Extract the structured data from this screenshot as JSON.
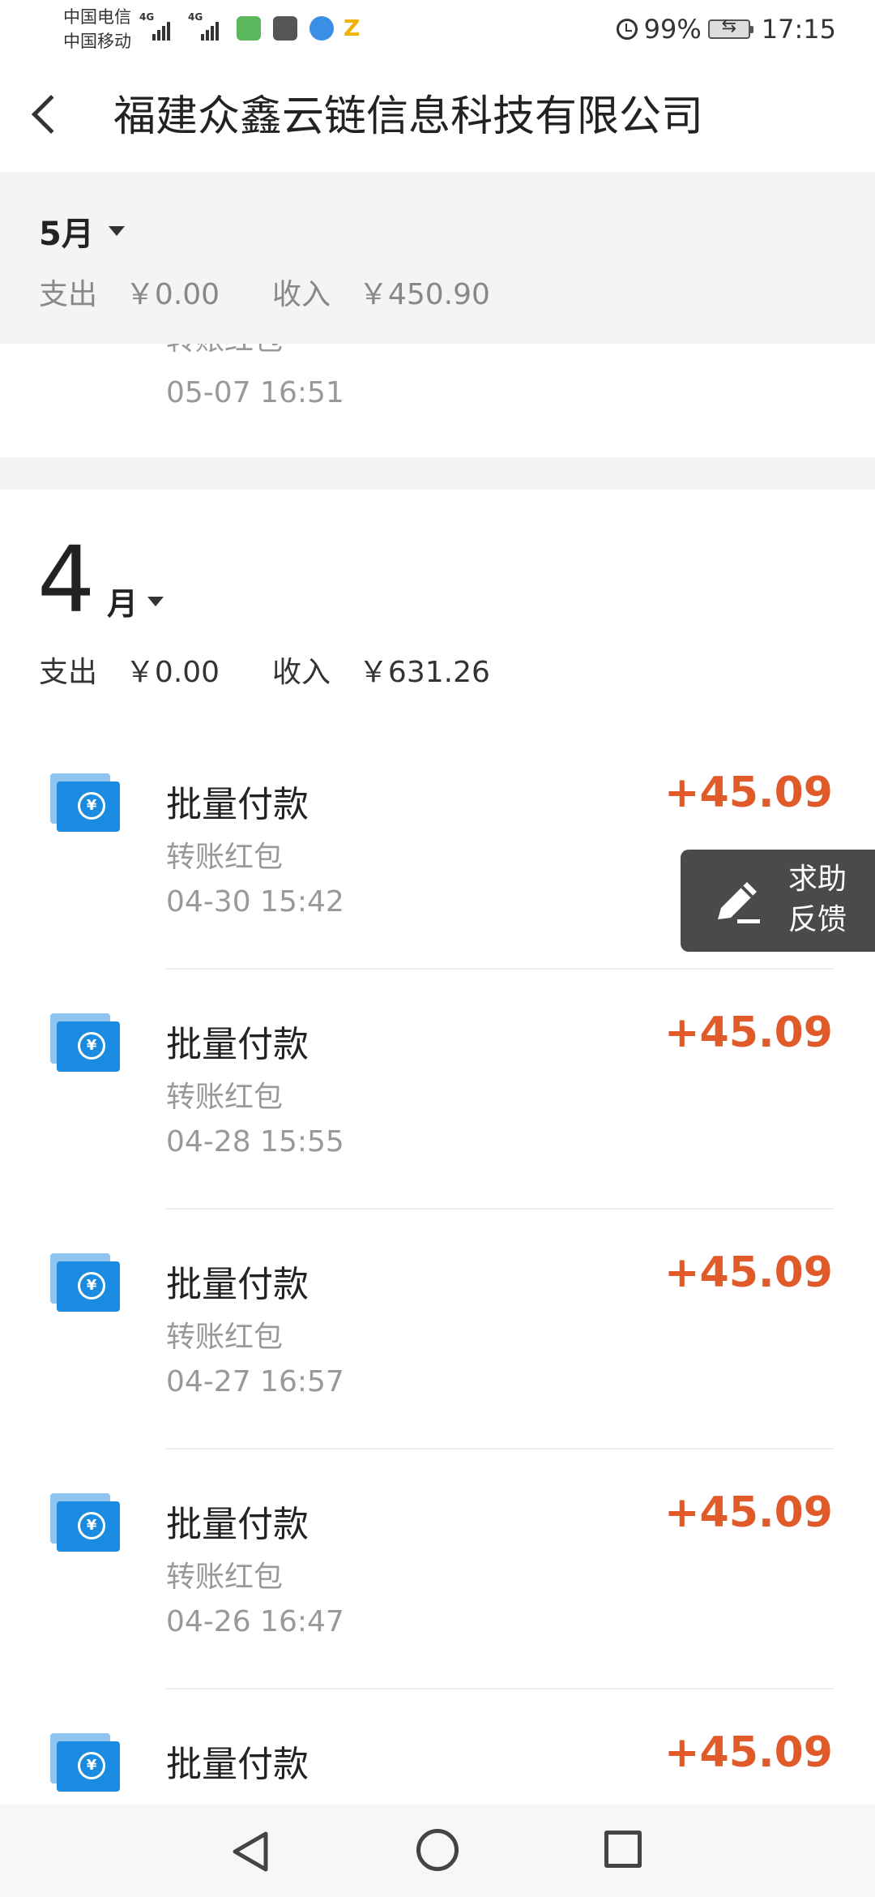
{
  "status_bar": {
    "carrier_1": "中国电信",
    "carrier_2": "中国移动",
    "signal_tag_1": "4G",
    "signal_tag_2": "4G",
    "battery": "99%",
    "time": "17:15"
  },
  "header": {
    "title": "福建众鑫云链信息科技有限公司"
  },
  "may_summary": {
    "month": "5月",
    "expense_label": "支出",
    "expense_value": "￥0.00",
    "income_label": "收入",
    "income_value": "￥450.90"
  },
  "partial_item": {
    "subtitle": "转账红包",
    "time": "05-07  16:51"
  },
  "april": {
    "month_num": "4",
    "month_unit": "月",
    "expense_label": "支出",
    "expense_value": "￥0.00",
    "income_label": "收入",
    "income_value": "￥631.26"
  },
  "transactions": [
    {
      "title": "批量付款",
      "subtitle": "转账红包",
      "time": "04-30  15:42",
      "amount": "+45.09"
    },
    {
      "title": "批量付款",
      "subtitle": "转账红包",
      "time": "04-28  15:55",
      "amount": "+45.09"
    },
    {
      "title": "批量付款",
      "subtitle": "转账红包",
      "time": "04-27  16:57",
      "amount": "+45.09"
    },
    {
      "title": "批量付款",
      "subtitle": "转账红包",
      "time": "04-26  16:47",
      "amount": "+45.09"
    },
    {
      "title": "批量付款",
      "amount": "+45.09"
    }
  ],
  "help_button": {
    "line_1": "求助",
    "line_2": "反馈"
  },
  "colors": {
    "amount": "#e05a2a",
    "icon_blue": "#1a8be0",
    "help_bg": "#4a4a4a"
  },
  "icons": {
    "back": "back-arrow-icon",
    "transfer": "yuan-transfer-icon",
    "help": "pencil-icon"
  }
}
